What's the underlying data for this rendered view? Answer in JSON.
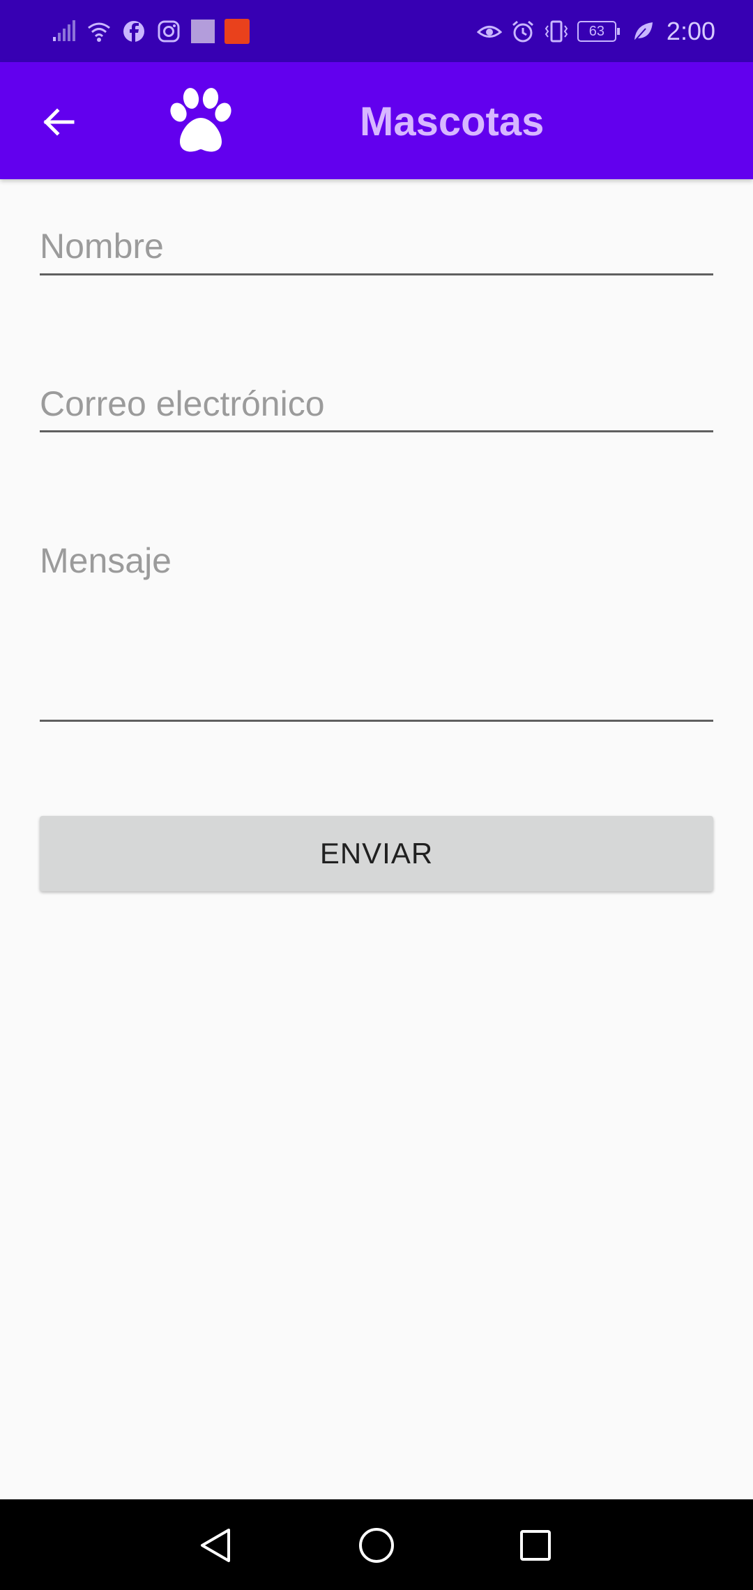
{
  "status_bar": {
    "battery_level": "63",
    "time": "2:00",
    "left_icons": [
      "signal-icon",
      "wifi-icon",
      "facebook-icon",
      "instagram-icon",
      "square-notification-icon",
      "aliexpress-icon"
    ],
    "right_icons": [
      "eye-comfort-icon",
      "alarm-icon",
      "vibrate-icon",
      "battery-icon",
      "leaf-icon"
    ]
  },
  "app_bar": {
    "back_icon": "arrow-back-icon",
    "logo_icon": "paw-icon",
    "title": "Mascotas",
    "background": "#6200ee",
    "title_color": "#d7b7ff"
  },
  "form": {
    "nombre_hint": "Nombre",
    "correo_hint": "Correo electrónico",
    "mensaje_hint": "Mensaje",
    "send_label": "ENVIAR"
  },
  "nav_bar": {
    "icons": [
      "nav-back-icon",
      "nav-home-icon",
      "nav-recent-icon"
    ]
  }
}
